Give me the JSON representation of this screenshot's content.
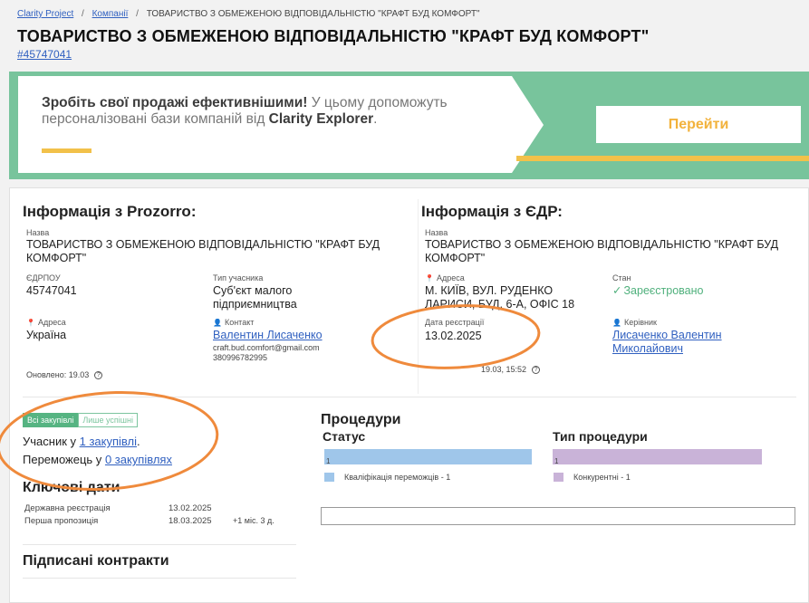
{
  "breadcrumb": {
    "items": [
      "Clarity Project",
      "Компанії"
    ],
    "current": "ТОВАРИСТВО З ОБМЕЖЕНОЮ ВІДПОВІДАЛЬНІСТЮ \"КРАФТ БУД КОМФОРТ\"",
    "separator": "/"
  },
  "page": {
    "title": "ТОВАРИСТВО З ОБМЕЖЕНОЮ ВІДПОВІДАЛЬНІСТЮ \"КРАФТ БУД КОМФОРТ\"",
    "company_id": "#45747041"
  },
  "banner": {
    "headline": "Зробіть свої продажі ефективнішими!",
    "text_1": " У цьому допоможуть персоналізовані бази компаній від ",
    "brand": "Clarity Explorer",
    "text_end": ".",
    "button_label": "Перейти",
    "colors": {
      "background": "#78c49c",
      "accent": "#f2c14a"
    }
  },
  "prozorro": {
    "title": "Інформація з Prozorro:",
    "name_label": "Назва",
    "name_value": "ТОВАРИСТВО З ОБМЕЖЕНОЮ ВІДПОВІДАЛЬНІСТЮ \"КРАФТ БУД КОМФОРТ\"",
    "edrpou_label": "ЄДРПОУ",
    "edrpou_value": "45747041",
    "type_label": "Тип учасника",
    "type_value": "Суб'єкт малого підприємництва",
    "address_label": "Адреса",
    "address_value": "Україна",
    "contact_label": "Контакт",
    "contact_name": "Валентин Лисаченко",
    "contact_email": "craft.bud.comfort@gmail.com",
    "contact_phone": "380996782995",
    "updated": "Оновлено: 19.03"
  },
  "edr": {
    "title": "Інформація з ЄДР:",
    "name_label": "Назва",
    "name_value": "ТОВАРИСТВО З ОБМЕЖЕНОЮ ВІДПОВІДАЛЬНІСТЮ \"КРАФТ БУД КОМФОРТ\"",
    "address_label": "Адреса",
    "address_value": "М. КИЇВ, ВУЛ. РУДЕНКО ЛАРИСИ, БУД. 6-А, ОФІС 18",
    "state_label": "Стан",
    "state_value": "Зареєстровано",
    "reg_date_label": "Дата реєстрації",
    "reg_date_value": "13.02.2025",
    "head_label": "Керівник",
    "head_value": "Лисаченко Валентин Миколайович",
    "updated": "19.03, 15:52"
  },
  "purchases": {
    "tab_all": "Всі закупівлі",
    "tab_successful": "Лише успішні",
    "participant_text": "Учасник у ",
    "participant_link": "1 закупівлі",
    "participant_end": ".",
    "winner_text": "Переможець у ",
    "winner_link": "0 закупівлях"
  },
  "key_dates": {
    "title": "Ключові дати",
    "rows": [
      {
        "label": "Державна реєстрація",
        "date": "13.02.2025",
        "extra": ""
      },
      {
        "label": "Перша пропозиція",
        "date": "18.03.2025",
        "extra": "+1 міс. 3 д."
      }
    ]
  },
  "contracts": {
    "title": "Підписані контракти"
  },
  "procedures": {
    "title": "Процедури",
    "status_title": "Статус",
    "type_title": "Тип процедури",
    "status_bar_value": "1",
    "type_bar_value": "1",
    "status_legend": "Кваліфікація переможців - 1",
    "type_legend": "Конкурентні - 1",
    "colors": {
      "status": "#9fc6ea",
      "type": "#c9b3d8"
    }
  },
  "chart_data": [
    {
      "type": "bar",
      "categories": [
        "Кваліфікація переможців"
      ],
      "values": [
        1
      ]
    },
    {
      "type": "bar",
      "categories": [
        "Конкурентні"
      ],
      "values": [
        1
      ]
    }
  ]
}
